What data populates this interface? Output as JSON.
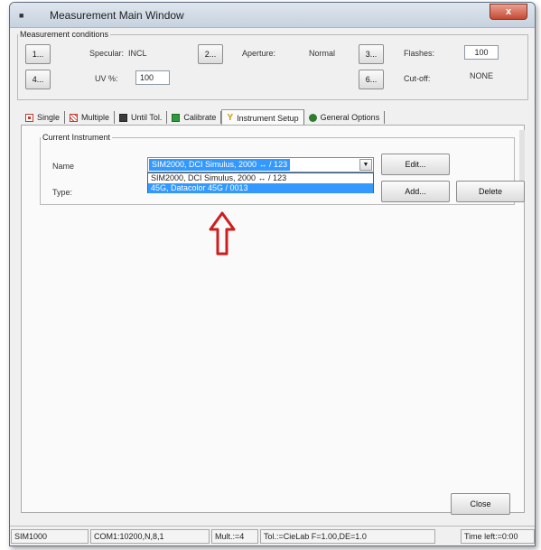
{
  "window": {
    "title": "Measurement Main Window",
    "close_label": "x"
  },
  "conditions": {
    "legend": "Measurement conditions",
    "btn1": "1...",
    "specular_label": "Specular:",
    "specular_value": "INCL",
    "btn2": "2...",
    "aperture_label": "Aperture:",
    "aperture_value": "Normal",
    "btn3": "3...",
    "flashes_label": "Flashes:",
    "flashes_value": "100",
    "btn4": "4...",
    "uv_label": "UV %:",
    "uv_value": "100",
    "btn6": "6...",
    "cutoff_label": "Cut-off:",
    "cutoff_value": "NONE"
  },
  "tabs": [
    {
      "label": "Single",
      "icon": "single-icon"
    },
    {
      "label": "Multiple",
      "icon": "multiple-icon"
    },
    {
      "label": "Until Tol.",
      "icon": "until-tol-icon"
    },
    {
      "label": "Calibrate",
      "icon": "calibrate-icon"
    },
    {
      "label": "Instrument Setup",
      "icon": "instrument-setup-icon",
      "active": true
    },
    {
      "label": "General Options",
      "icon": "general-options-icon"
    }
  ],
  "instrument": {
    "legend": "Current Instrument",
    "name_label": "Name",
    "type_label": "Type:",
    "combo_value": "SIM2000, DCI Simulus, 2000 ↔ / 123",
    "options": [
      "SIM2000, DCI Simulus, 2000 ↔ / 123",
      "45G, Datacolor 45G / 0013"
    ],
    "highlighted_index": 1,
    "edit_button": "Edit...",
    "add_button": "Add...",
    "delete_button": "Delete"
  },
  "close_button": "Close",
  "status": {
    "instrument": "SIM1000",
    "port": "COM1:10200,N,8,1",
    "mult": "Mult.:=4",
    "tol": "Tol.:=CieLab F=1.00,DE=1.0",
    "time_left": "Time left:=0:00"
  },
  "colors": {
    "highlight": "#3399ff",
    "annotation_arrow": "#cc1f1f"
  }
}
